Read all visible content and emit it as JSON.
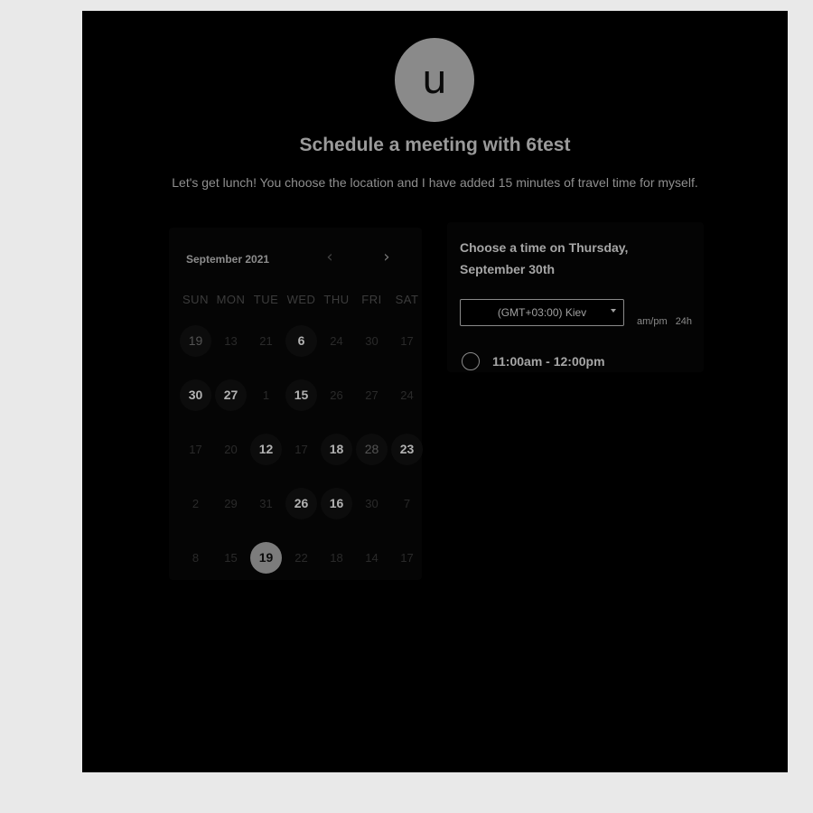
{
  "profile": {
    "avatar_letter": "u"
  },
  "header": {
    "title": "Schedule a meeting with 6test",
    "description": "Let's get lunch! You choose the location and I have added 15 minutes of travel time for myself."
  },
  "calendar": {
    "month_label": "September 2021",
    "prev_icon": "chevron-left-icon",
    "next_icon": "chevron-right-icon",
    "weekdays": [
      "SUN",
      "MON",
      "TUE",
      "WED",
      "THU",
      "FRI",
      "SAT"
    ],
    "days": [
      {
        "label": "19",
        "state": "muted"
      },
      {
        "label": "13",
        "state": "faint"
      },
      {
        "label": "21",
        "state": "faint"
      },
      {
        "label": "6",
        "state": "available"
      },
      {
        "label": "24",
        "state": "faint"
      },
      {
        "label": "30",
        "state": "faint"
      },
      {
        "label": "17",
        "state": "faint"
      },
      {
        "label": "30",
        "state": "available"
      },
      {
        "label": "27",
        "state": "available"
      },
      {
        "label": "1",
        "state": "faint"
      },
      {
        "label": "15",
        "state": "available"
      },
      {
        "label": "26",
        "state": "faint"
      },
      {
        "label": "27",
        "state": "faint"
      },
      {
        "label": "24",
        "state": "faint"
      },
      {
        "label": "17",
        "state": "faint"
      },
      {
        "label": "20",
        "state": "faint"
      },
      {
        "label": "12",
        "state": "available"
      },
      {
        "label": "17",
        "state": "faint"
      },
      {
        "label": "18",
        "state": "available"
      },
      {
        "label": "28",
        "state": "muted"
      },
      {
        "label": "23",
        "state": "available"
      },
      {
        "label": "2",
        "state": "faint"
      },
      {
        "label": "29",
        "state": "faint"
      },
      {
        "label": "31",
        "state": "faint"
      },
      {
        "label": "26",
        "state": "available"
      },
      {
        "label": "16",
        "state": "available"
      },
      {
        "label": "30",
        "state": "faint"
      },
      {
        "label": "7",
        "state": "faint"
      },
      {
        "label": "8",
        "state": "faint"
      },
      {
        "label": "15",
        "state": "faint"
      },
      {
        "label": "19",
        "state": "selected"
      },
      {
        "label": "22",
        "state": "faint"
      },
      {
        "label": "18",
        "state": "faint"
      },
      {
        "label": "14",
        "state": "faint"
      },
      {
        "label": "17",
        "state": "faint"
      }
    ]
  },
  "times": {
    "heading": "Choose a time on Thursday, September 30th",
    "timezone": "(GMT+03:00) Kiev",
    "format_12": "am/pm",
    "format_24": "24h",
    "slots": [
      "11:00am - 12:00pm"
    ]
  }
}
